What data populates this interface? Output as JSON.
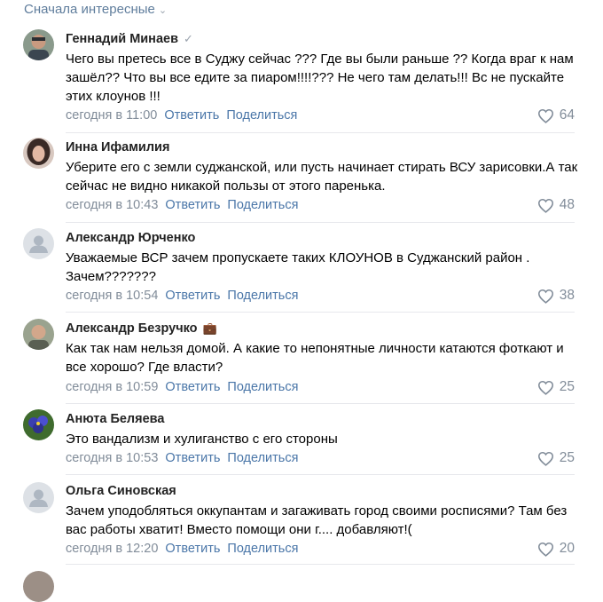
{
  "sort_label": "Сначала интересные",
  "actions": {
    "reply": "Ответить",
    "share": "Поделиться"
  },
  "comments": [
    {
      "author": "Геннадий Минаев",
      "badge": "✓",
      "text": "Чего вы претесь все в Суджу сейчас ??? Где вы были раньше ?? Когда враг к нам зашёл?? Что вы все едите за пиаром!!!!??? Не чего там делать!!! Вс не пускайте этих клоунов !!!",
      "time": "сегодня в 11:00",
      "likes": "64"
    },
    {
      "author": "Инна Ифамилия",
      "badge": "",
      "text": "Уберите его с земли суджанской, или пусть начинает стирать ВСУ зарисовки.А так сейчас не видно никакой пользы от этого паренька.",
      "time": "сегодня в 10:43",
      "likes": "48"
    },
    {
      "author": "Александр Юрченко",
      "badge": "",
      "text": "Уважаемые ВСР зачем пропускаете таких КЛОУНОВ в Суджанский район . Зачем???????",
      "time": "сегодня в 10:54",
      "likes": "38"
    },
    {
      "author": "Александр Безручко",
      "badge": "💼",
      "text": "Как так нам нельзя домой. А какие то непонятные личности катаются фоткают и все хорошо? Где власти?",
      "time": "сегодня в 10:59",
      "likes": "25"
    },
    {
      "author": "Анюта Беляева",
      "badge": "",
      "text": "Это вандализм и хулиганство с его стороны",
      "time": "сегодня в 10:53",
      "likes": "25"
    },
    {
      "author": "Ольга Синовская",
      "badge": "",
      "text": "Зачем уподобляться оккупантам и загаживать город своими росписями? Там без вас работы хватит! Вместо помощи они г.... добавляют!(",
      "time": "сегодня в 12:20",
      "likes": "20"
    }
  ]
}
